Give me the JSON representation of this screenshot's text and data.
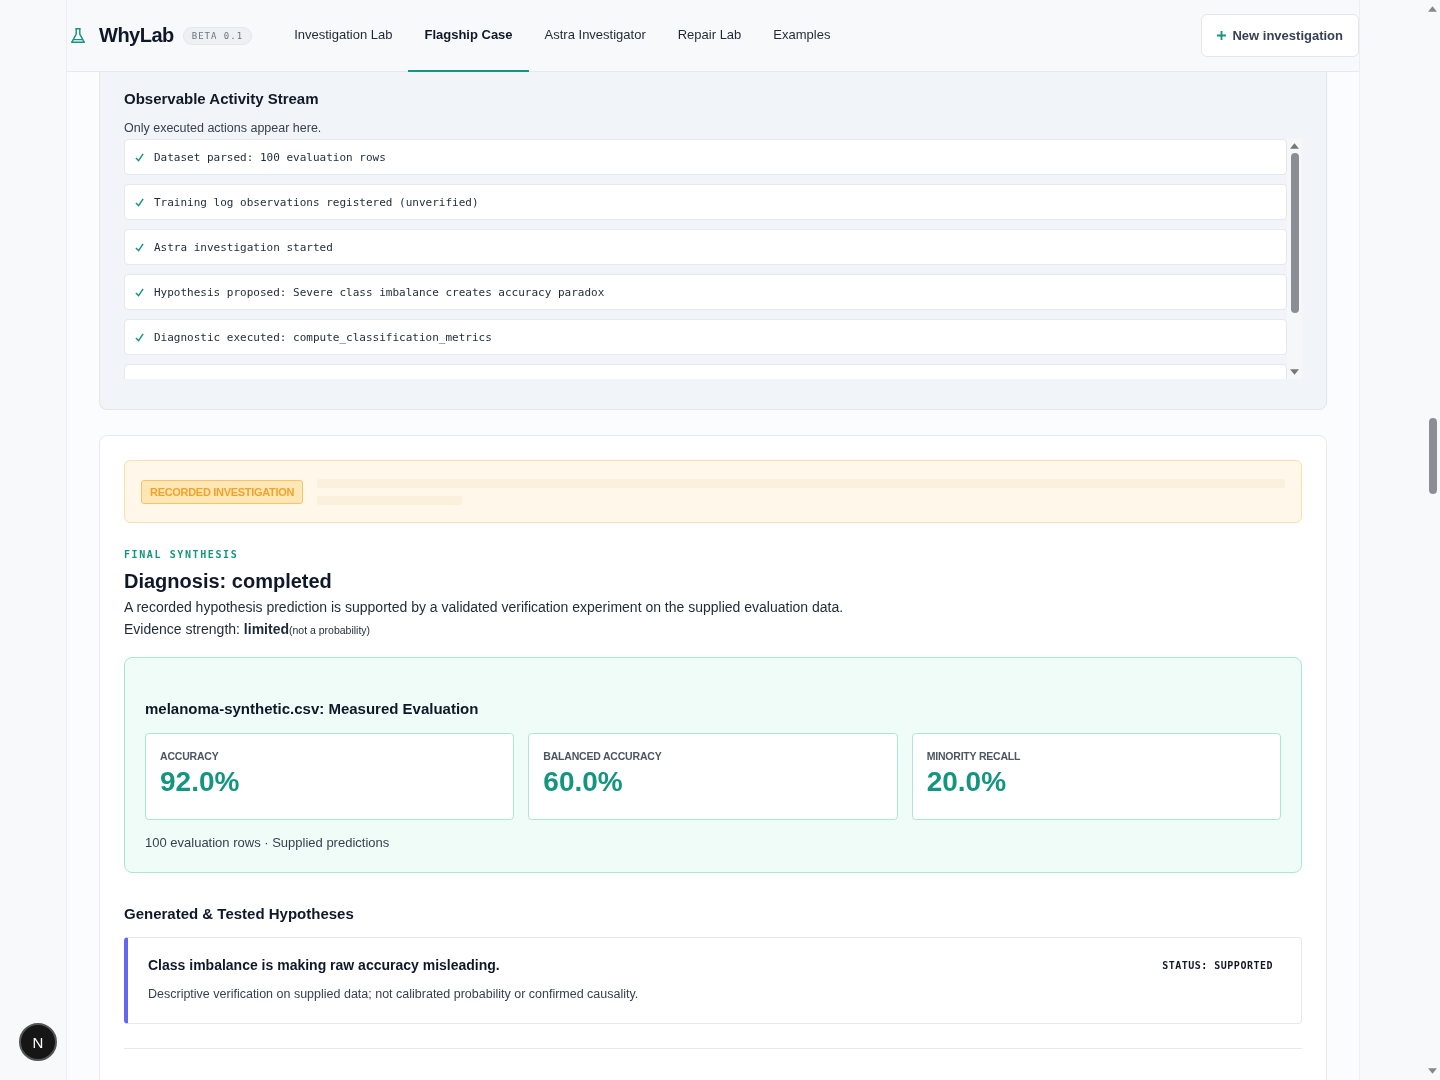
{
  "header": {
    "logo": "WhyLab",
    "badge": "BETA 0.1",
    "nav": [
      {
        "label": "Investigation Lab",
        "selected": false
      },
      {
        "label": "Flagship Case",
        "selected": true
      },
      {
        "label": "Astra Investigator",
        "selected": false
      },
      {
        "label": "Repair Lab",
        "selected": false
      },
      {
        "label": "Examples",
        "selected": false
      }
    ],
    "new_button": "New investigation"
  },
  "activity_stream": {
    "title": "Observable Activity Stream",
    "subtitle": "Only executed actions appear here.",
    "items": [
      {
        "text": "Dataset parsed: 100 evaluation rows",
        "done": true
      },
      {
        "text": "Training log observations registered (unverified)",
        "done": true
      },
      {
        "text": "Astra investigation started",
        "done": true
      },
      {
        "text": "Hypothesis proposed: Severe class imbalance creates accuracy paradox",
        "done": true
      },
      {
        "text": "Diagnostic executed: compute_classification_metrics",
        "done": true
      }
    ]
  },
  "synthesis": {
    "recorded_tag": "RECORDED INVESTIGATION",
    "eyebrow": "FINAL SYNTHESIS",
    "title": "Diagnosis: completed",
    "summary": "A recorded hypothesis prediction is supported by a validated verification experiment on the supplied evaluation data.",
    "evidence_label": "Evidence strength:",
    "evidence_value": "limited",
    "evidence_note": "(not a probability)",
    "evaluation": {
      "title": "melanoma-synthetic.csv: Measured Evaluation",
      "metrics": [
        {
          "label": "ACCURACY",
          "value": "92.0%"
        },
        {
          "label": "BALANCED ACCURACY",
          "value": "60.0%"
        },
        {
          "label": "MINORITY RECALL",
          "value": "20.0%"
        }
      ],
      "footnote": "100 evaluation rows · Supplied predictions"
    },
    "hypotheses_title": "Generated & Tested Hypotheses",
    "hypotheses": [
      {
        "title": "Class imbalance is making raw accuracy misleading.",
        "status": "STATUS: SUPPORTED",
        "detail": "Descriptive verification on supplied data; not calibrated probability or confirmed causality."
      }
    ]
  },
  "dev_badge": "N"
}
